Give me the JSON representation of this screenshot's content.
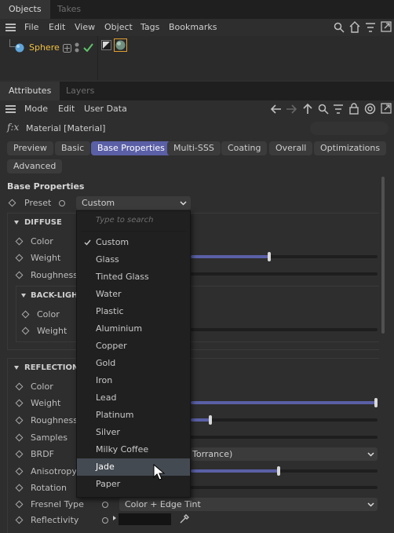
{
  "objects_panel": {
    "tabs": [
      {
        "label": "Objects",
        "active": true
      },
      {
        "label": "Takes",
        "active": false
      }
    ],
    "menu": [
      "File",
      "Edit",
      "View",
      "Object",
      "Tags",
      "Bookmarks"
    ],
    "toolbar_icons": [
      "search-icon",
      "home-icon",
      "filter-icon",
      "maximize-icon"
    ],
    "row": {
      "name": "Sphere",
      "name_color": "#f0c040",
      "enabled": true
    }
  },
  "attributes_panel": {
    "tabs": [
      {
        "label": "Attributes",
        "active": true
      },
      {
        "label": "Layers",
        "active": false
      }
    ],
    "menu": [
      "Mode",
      "Edit",
      "User Data"
    ],
    "toolbar_icons": [
      "back-arrow-icon",
      "forward-arrow-icon",
      "up-arrow-icon",
      "search-icon",
      "filter-icon",
      "lock-icon",
      "target-icon",
      "maximize-icon"
    ],
    "fx_label": "f:x",
    "header_title": "Material [Material]",
    "tabs_row": [
      "Preview",
      "Basic",
      "Base Properties",
      "Multi-SSS",
      "Coating",
      "Overall",
      "Optimizations",
      "Advanced"
    ],
    "active_tab": "Base Properties",
    "section_title": "Base Properties",
    "preset_label": "Preset",
    "preset_value": "Custom",
    "diffuse": {
      "title": "DIFFUSE",
      "rows": [
        {
          "label": "Color"
        },
        {
          "label": "Weight",
          "value_fraction": 0.43
        },
        {
          "label": "Roughness",
          "value_fraction": 0.0
        }
      ],
      "backlight": {
        "title": "BACK-LIGHT",
        "rows": [
          {
            "label": "Color"
          },
          {
            "label": "Weight"
          }
        ]
      }
    },
    "reflection": {
      "title": "REFLECTION",
      "rows": [
        {
          "label": "Color"
        },
        {
          "label": "Weight",
          "value_fraction": 1.0
        },
        {
          "label": "Roughness",
          "value_fraction": 0.1
        },
        {
          "label": "Samples"
        },
        {
          "label": "BRDF",
          "value": "Torrance)"
        },
        {
          "label": "Anisotropy",
          "value_fraction": 0.47
        },
        {
          "label": "Rotation"
        },
        {
          "label": "Fresnel Type",
          "value": "Color + Edge Tint"
        },
        {
          "label": "Reflectivity"
        }
      ]
    }
  },
  "preset_menu": {
    "search_placeholder": "Type to search",
    "items": [
      "Custom",
      "Glass",
      "Tinted Glass",
      "Water",
      "Plastic",
      "Aluminium",
      "Copper",
      "Gold",
      "Iron",
      "Lead",
      "Platinum",
      "Silver",
      "Milky Coffee",
      "Jade",
      "Paper"
    ],
    "checked": "Custom",
    "hovered": "Jade"
  },
  "colors": {
    "accent": "#5a5fa6",
    "sphere_label": "#f0c040",
    "checkmark": "#5ec26a"
  }
}
